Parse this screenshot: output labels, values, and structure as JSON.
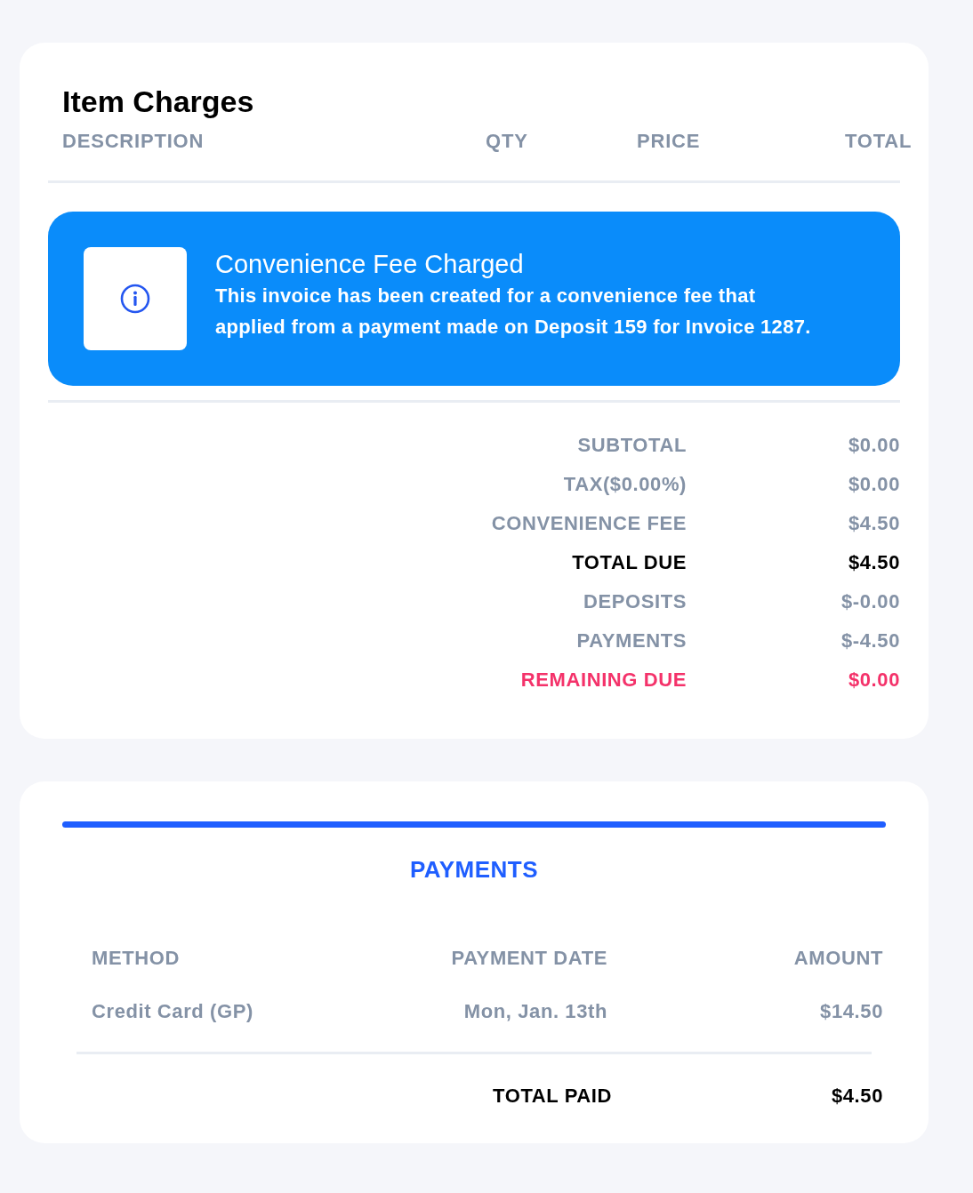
{
  "item_charges": {
    "title": "Item Charges",
    "columns": [
      "DESCRIPTION",
      "QTY",
      "PRICE",
      "TOTAL"
    ]
  },
  "notice": {
    "title": "Convenience Fee Charged",
    "message": "This invoice has been created for a convenience fee that applied from a payment made on Deposit 159 for Invoice 1287."
  },
  "summary": [
    {
      "label": "SUBTOTAL",
      "value": "$0.00",
      "kind": "normal"
    },
    {
      "label": "TAX($0.00%)",
      "value": "$0.00",
      "kind": "normal"
    },
    {
      "label": "CONVENIENCE FEE",
      "value": "$4.50",
      "kind": "normal"
    },
    {
      "label": "TOTAL DUE",
      "value": "$4.50",
      "kind": "total"
    },
    {
      "label": "DEPOSITS",
      "value": "$-0.00",
      "kind": "normal"
    },
    {
      "label": "PAYMENTS",
      "value": "$-4.50",
      "kind": "normal"
    },
    {
      "label": "REMAINING DUE",
      "value": "$0.00",
      "kind": "remaining"
    }
  ],
  "payments": {
    "title": "PAYMENTS",
    "columns": [
      "METHOD",
      "PAYMENT DATE",
      "AMOUNT"
    ],
    "rows": [
      {
        "method": "Credit Card (GP)",
        "date": "Mon, Jan. 13th",
        "amount": "$14.50"
      }
    ],
    "total_label": "TOTAL PAID",
    "total_value": "$4.50"
  }
}
